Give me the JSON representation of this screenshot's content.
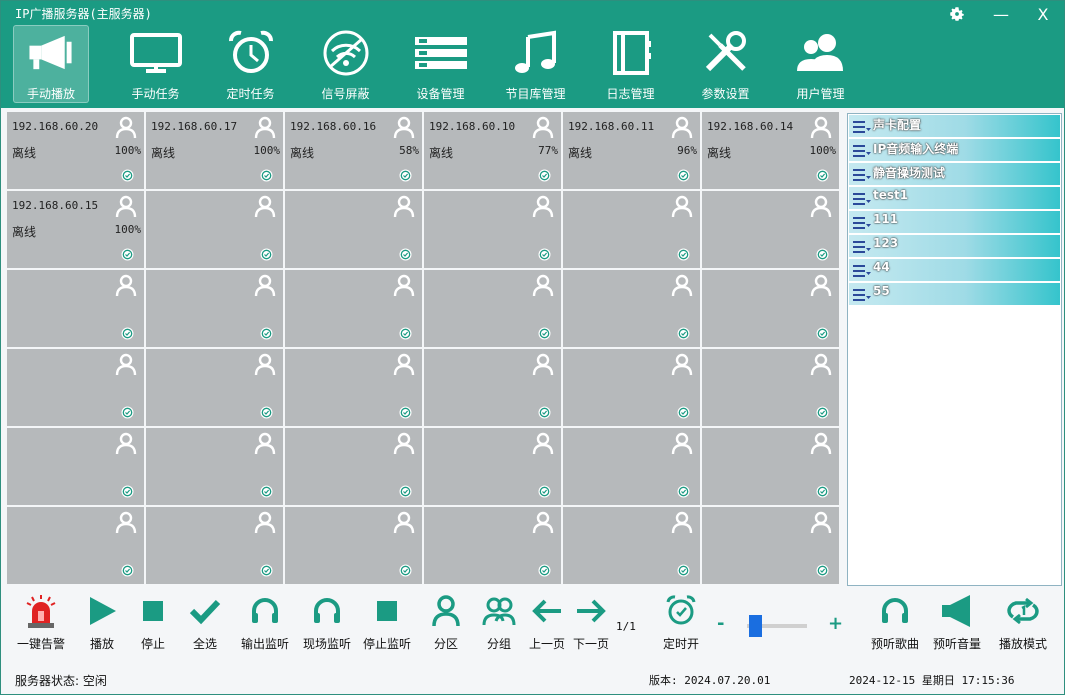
{
  "window": {
    "title": "IP广播服务器(主服务器)",
    "minimize": "—",
    "close": "X"
  },
  "nav": [
    {
      "label": "手动播放",
      "icon": "megaphone-icon",
      "active": true
    },
    {
      "label": "手动任务",
      "icon": "monitor-icon"
    },
    {
      "label": "定时任务",
      "icon": "alarm-clock-icon"
    },
    {
      "label": "信号屏蔽",
      "icon": "wifi-off-icon"
    },
    {
      "label": "设备管理",
      "icon": "server-rack-icon"
    },
    {
      "label": "节目库管理",
      "icon": "music-note-icon"
    },
    {
      "label": "日志管理",
      "icon": "notebook-icon"
    },
    {
      "label": "参数设置",
      "icon": "tools-icon"
    },
    {
      "label": "用户管理",
      "icon": "users-icon"
    }
  ],
  "terminals": [
    {
      "ip": "192.168.60.20",
      "status": "离线",
      "volume": "100%"
    },
    {
      "ip": "192.168.60.17",
      "status": "离线",
      "volume": "100%"
    },
    {
      "ip": "192.168.60.16",
      "status": "离线",
      "volume": "58%"
    },
    {
      "ip": "192.168.60.10",
      "status": "离线",
      "volume": "77%"
    },
    {
      "ip": "192.168.60.11",
      "status": "离线",
      "volume": "96%"
    },
    {
      "ip": "192.168.60.14",
      "status": "离线",
      "volume": "100%"
    },
    {
      "ip": "192.168.60.15",
      "status": "离线",
      "volume": "100%"
    }
  ],
  "grid": {
    "rows": 6,
    "cols": 6
  },
  "panel": {
    "items": [
      "声卡配置",
      "IP音频输入终端",
      "静音操场测试",
      "test1",
      "111",
      "123",
      "44",
      "55"
    ]
  },
  "toolbar": {
    "alarm": "一键告警",
    "play": "播放",
    "stop": "停止",
    "select_all": "全选",
    "output_monitor": "输出监听",
    "live_monitor": "现场监听",
    "stop_monitor": "停止监听",
    "zone": "分区",
    "group": "分组",
    "prev_page": "上一页",
    "next_page": "下一页",
    "page": "1/1",
    "timer_on": "定时开",
    "vol_minus": "-",
    "vol_plus": "+",
    "volume_level": 0.05,
    "preview_song": "预听歌曲",
    "preview_volume": "预听音量",
    "play_mode": "播放模式"
  },
  "statusbar": {
    "server_status": "服务器状态: 空闲",
    "version": "版本: 2024.07.20.01",
    "datetime": "2024-12-15 星期日 17:15:36"
  },
  "colors": {
    "header": "#1b9b83",
    "accent": "#1b9b83",
    "cell": "#b6b9bb",
    "panel_gradient_end": "#35c4cc",
    "alarm_red": "#e02222"
  }
}
